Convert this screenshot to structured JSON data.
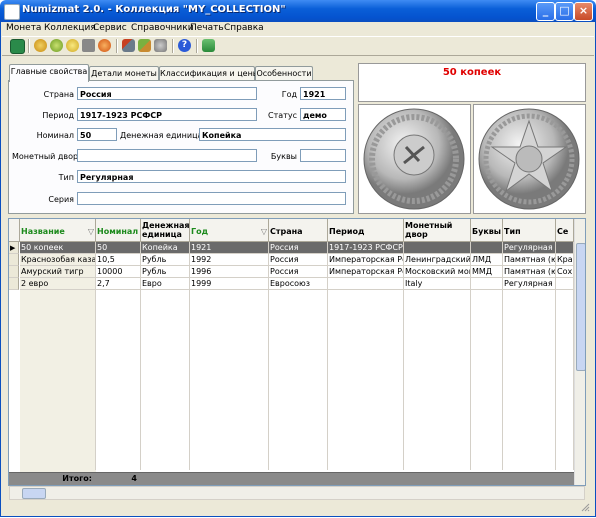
{
  "window": {
    "title": "Numizmat 2.0. - Коллекция \"MY_COLLECTION\""
  },
  "menu": [
    "Монета",
    "Коллекция",
    "Сервис",
    "Справочники",
    "Печать",
    "Справка"
  ],
  "toolbar_icons": [
    "open-icon",
    "coin-gold-icon",
    "coin-green-icon",
    "coin-yellow-icon",
    "folder-icon",
    "coin-red-icon",
    "tools-icon",
    "brush-icon",
    "search-icon",
    "help-icon",
    "exit-icon"
  ],
  "tabs": [
    "Главные свойства",
    "Детали монеты",
    "Классификация и цены",
    "Особенности"
  ],
  "form": {
    "country_label": "Страна",
    "country": "Россия",
    "year_label": "Год",
    "year": "1921",
    "period_label": "Период",
    "period": "1917-1923 РСФСР",
    "status_label": "Статус",
    "status": "демо",
    "nominal_label": "Номинал",
    "nominal": "50",
    "currency_label": "Денежная единица",
    "currency": "Копейка",
    "mint_label": "Монетный двор",
    "mint": "",
    "letters_label": "Буквы",
    "letters": "",
    "type_label": "Тип",
    "type": "Регулярная",
    "series_label": "Серия",
    "series": ""
  },
  "coin_title": "50 копеек",
  "colors": {
    "accent_red": "#e00000",
    "header_green": "#1c8a1c",
    "selection": "#6a6a6a"
  },
  "grid": {
    "headers": [
      "Название",
      "Номинал",
      "Денежная единица",
      "Год",
      "Страна",
      "Период",
      "Монетный двор",
      "Буквы",
      "Тип",
      "Се"
    ],
    "rows": [
      [
        "50 копеек",
        "50",
        "Копейка",
        "1921",
        "Россия",
        "1917-1923 РСФСР",
        "",
        "",
        "Регулярная",
        ""
      ],
      [
        "Краснозобая казарка",
        "10,5",
        "Рубль",
        "1992",
        "Россия",
        "Императорская Россия",
        "Ленинградский монетный двор",
        "ЛМД",
        "Памятная (юбилейная)",
        "Кра"
      ],
      [
        "Амурский тигр",
        "10000",
        "Рубль",
        "1996",
        "Россия",
        "Императорская Россия",
        "Московский монетный двор",
        "ММД",
        "Памятная (юбилейная)",
        "Сох"
      ],
      [
        "2 евро",
        "2,7",
        "Евро",
        "1999",
        "Евросоюз",
        "",
        "Italy",
        "",
        "Регулярная",
        ""
      ]
    ],
    "footer_label": "Итого:",
    "footer_count": "4"
  }
}
